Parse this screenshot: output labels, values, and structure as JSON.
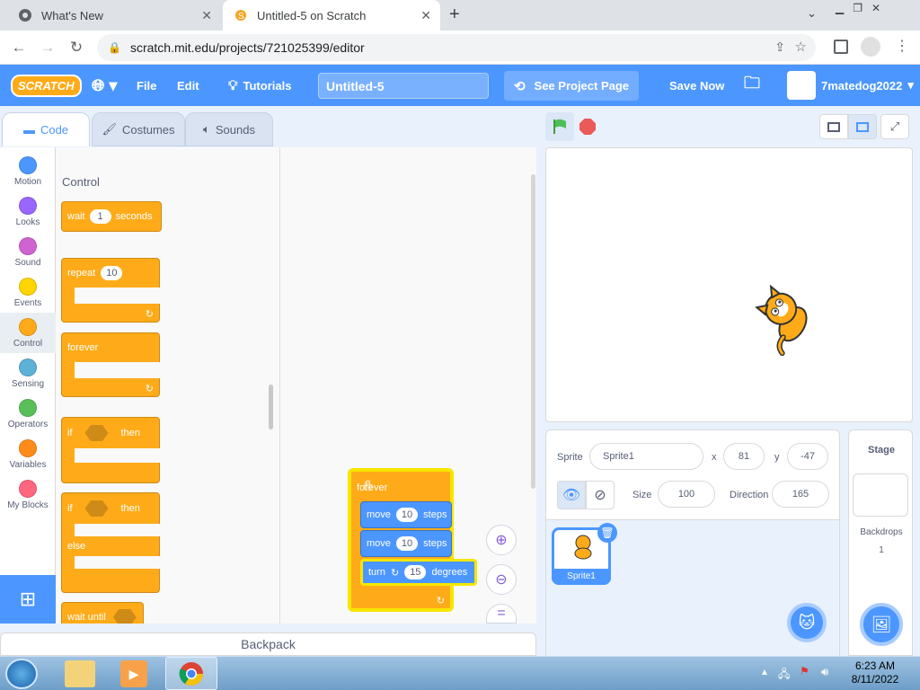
{
  "browser": {
    "tabs": [
      {
        "title": "What's New"
      },
      {
        "title": "Untitled-5 on Scratch"
      }
    ],
    "url": "scratch.mit.edu/projects/721025399/editor"
  },
  "menubar": {
    "logo": "SCRATCH",
    "file": "File",
    "edit": "Edit",
    "tutorials": "Tutorials",
    "project_title": "Untitled-5",
    "see_project_page": "See Project Page",
    "save_now": "Save Now",
    "username": "7matedog2022"
  },
  "editor_tabs": {
    "code": "Code",
    "costumes": "Costumes",
    "sounds": "Sounds"
  },
  "categories": [
    {
      "label": "Motion",
      "color": "#4c97ff"
    },
    {
      "label": "Looks",
      "color": "#9966ff"
    },
    {
      "label": "Sound",
      "color": "#cf63cf"
    },
    {
      "label": "Events",
      "color": "#ffd500"
    },
    {
      "label": "Control",
      "color": "#ffab19"
    },
    {
      "label": "Sensing",
      "color": "#5cb1d6"
    },
    {
      "label": "Operators",
      "color": "#59c059"
    },
    {
      "label": "Variables",
      "color": "#ff8c1a"
    },
    {
      "label": "My Blocks",
      "color": "#ff6680"
    }
  ],
  "palette": {
    "section_title": "Control",
    "wait": {
      "a": "wait",
      "value": "1",
      "b": "seconds"
    },
    "repeat": {
      "a": "repeat",
      "value": "10"
    },
    "forever": "forever",
    "if_then": {
      "a": "if",
      "b": "then"
    },
    "if_else": {
      "a": "if",
      "b": "then",
      "c": "else"
    },
    "wait_until": "wait until"
  },
  "script": {
    "hat": "forever",
    "move1": {
      "a": "move",
      "value": "10",
      "b": "steps"
    },
    "move2": {
      "a": "move",
      "value": "10",
      "b": "steps"
    },
    "turn": {
      "a": "turn",
      "value": "15",
      "b": "degrees"
    }
  },
  "backpack": "Backpack",
  "sprite_info": {
    "sprite_label": "Sprite",
    "sprite_name": "Sprite1",
    "x_label": "x",
    "x_value": "81",
    "y_label": "y",
    "y_value": "-47",
    "size_label": "Size",
    "size_value": "100",
    "direction_label": "Direction",
    "direction_value": "165"
  },
  "sprite_list": [
    {
      "name": "Sprite1"
    }
  ],
  "stage_panel": {
    "title": "Stage",
    "backdrops_label": "Backdrops",
    "backdrops_count": "1"
  },
  "taskbar": {
    "time": "6:23 AM",
    "date": "8/11/2022"
  }
}
